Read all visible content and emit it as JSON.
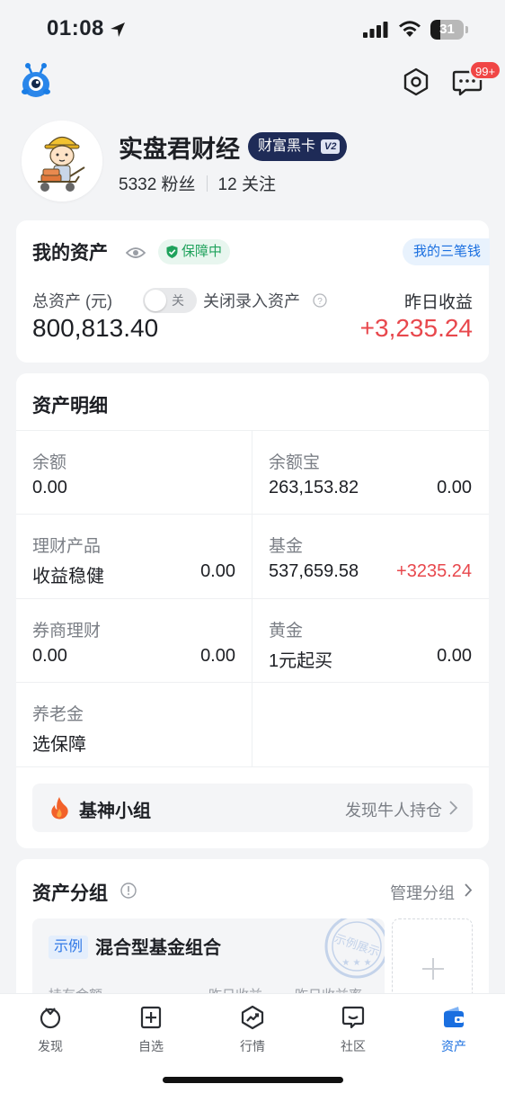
{
  "status": {
    "time": "01:08",
    "battery": "31",
    "battery_level": 0.31
  },
  "header": {
    "message_badge": "99+"
  },
  "profile": {
    "name": "实盘君财经",
    "vip_label": "财富黑卡",
    "vip_level": "V2",
    "fans": "5332 粉丝",
    "follows": "12 关注"
  },
  "assets": {
    "title": "我的资产",
    "protect_label": "保障中",
    "three_money": "我的三笔钱",
    "total_label": "总资产 (元)",
    "toggle_label": "关",
    "close_entry": "关闭录入资产",
    "total_value": "800,813.40",
    "yield_label": "昨日收益",
    "yield_value": "+3,235.24"
  },
  "detail": {
    "title": "资产明细",
    "cells": [
      {
        "label": "余额",
        "left": "0.00",
        "right": ""
      },
      {
        "label": "余额宝",
        "left": "263,153.82",
        "right": "0.00"
      },
      {
        "label": "理财产品",
        "left": "收益稳健",
        "right": "0.00"
      },
      {
        "label": "基金",
        "left": "537,659.58",
        "right": "+3235.24"
      },
      {
        "label": "券商理财",
        "left": "0.00",
        "right": "0.00"
      },
      {
        "label": "黄金",
        "left": "1元起买",
        "right": "0.00"
      },
      {
        "label": "养老金",
        "left": "选保障",
        "right": ""
      }
    ],
    "fund_group": {
      "title": "基神小组",
      "link": "发现牛人持仓"
    }
  },
  "groups": {
    "title": "资产分组",
    "manage": "管理分组",
    "sample": {
      "tag": "示例",
      "title": "混合型基金组合",
      "col_hold": "持有金额",
      "col_yield": "昨日收益",
      "col_rate": "昨日收益率",
      "stamp": "示例展示"
    }
  },
  "tabs": [
    {
      "label": "发现",
      "icon": "discover-icon"
    },
    {
      "label": "自选",
      "icon": "watchlist-icon"
    },
    {
      "label": "行情",
      "icon": "market-icon"
    },
    {
      "label": "社区",
      "icon": "community-icon"
    },
    {
      "label": "资产",
      "icon": "wallet-icon"
    }
  ],
  "colors": {
    "accent": "#1a6fe0",
    "gain": "#e8484d",
    "protect": "#1fa25c",
    "vip": "#1e2b57"
  }
}
